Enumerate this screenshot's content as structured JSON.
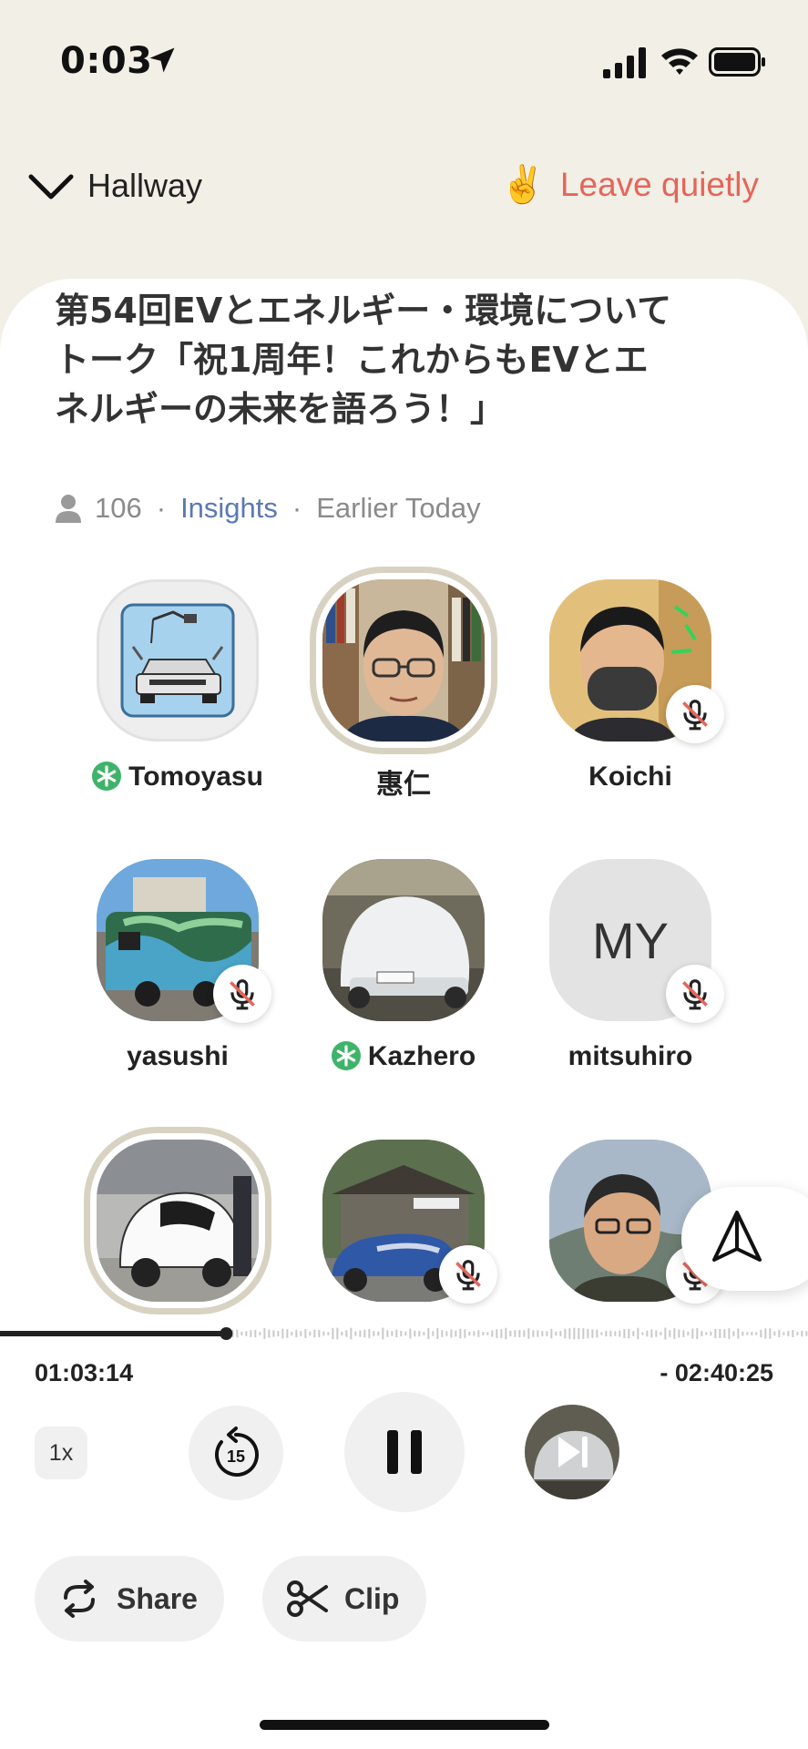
{
  "status_bar": {
    "time": "0:03"
  },
  "header": {
    "back_label": "Hallway",
    "leave_emoji": "✌️",
    "leave_label": "Leave quietly"
  },
  "room": {
    "title": "第54回EVとエネルギー・環境についてトーク「祝1周年！これからもEVとエネルギーの未来を語ろう！」",
    "listener_count": "106",
    "separator": "·",
    "insights_label": "Insights",
    "time_label": "Earlier Today"
  },
  "speakers": [
    {
      "name": "Tomoyasu",
      "badge": "moderator-star",
      "muted": false
    },
    {
      "name": "惠仁",
      "badge": "",
      "muted": false,
      "speaking": true
    },
    {
      "name": "Koichi",
      "badge": "",
      "muted": true
    },
    {
      "name": "yasushi",
      "badge": "",
      "muted": true
    },
    {
      "name": "Kazhero",
      "badge": "moderator-star",
      "muted": false
    },
    {
      "name": "mitsuhiro",
      "initials": "MY",
      "badge": "",
      "muted": true
    },
    {
      "name": "",
      "badge": "",
      "muted": false,
      "speaking": true
    },
    {
      "name": "",
      "badge": "",
      "muted": true
    },
    {
      "name": "",
      "badge": "",
      "muted": true
    }
  ],
  "player": {
    "elapsed": "01:03:14",
    "remaining": "- 02:40:25",
    "progress": 0.28,
    "speed_label": "1x",
    "rewind_label": "15",
    "share_label": "Share",
    "clip_label": "Clip"
  },
  "colors": {
    "background": "#f1efe6",
    "leave": "#e5655a",
    "insights": "#5a79b0",
    "moderator_star": "#3fb36a"
  }
}
